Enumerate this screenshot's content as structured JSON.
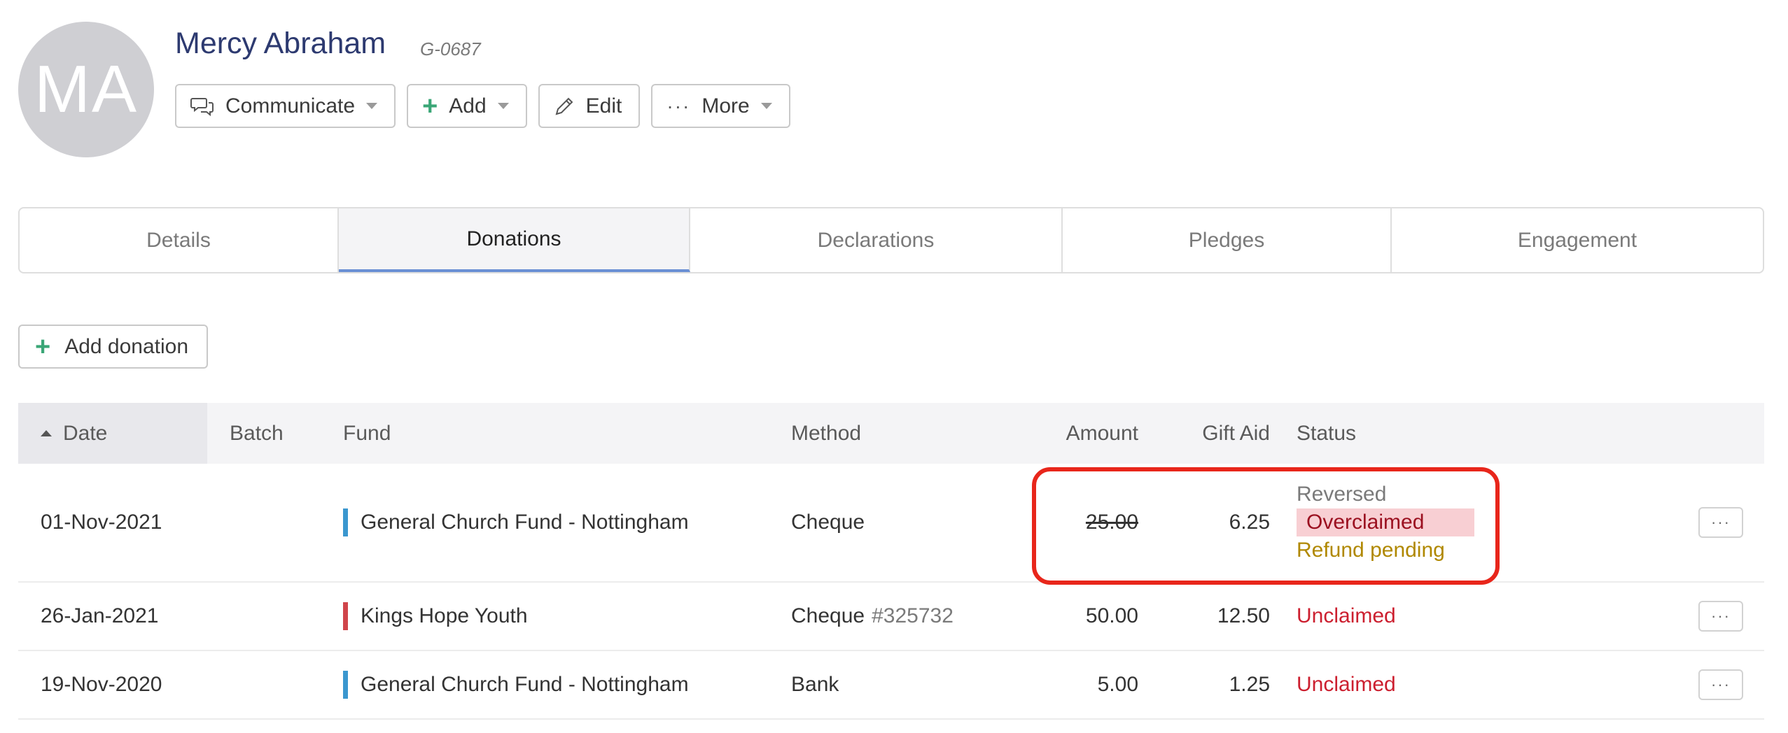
{
  "profile": {
    "initials": "MA",
    "name": "Mercy Abraham",
    "id": "G-0687"
  },
  "actions": [
    {
      "label": "Communicate",
      "icon": "chat-bubbles-icon",
      "dropdown": true
    },
    {
      "label": "Add",
      "icon": "plus-icon",
      "dropdown": true
    },
    {
      "label": "Edit",
      "icon": "pencil-icon",
      "dropdown": false
    },
    {
      "label": "More",
      "icon": "ellipsis-icon",
      "dropdown": true
    }
  ],
  "tabs": [
    {
      "label": "Details",
      "active": false
    },
    {
      "label": "Donations",
      "active": true
    },
    {
      "label": "Declarations",
      "active": false
    },
    {
      "label": "Pledges",
      "active": false
    },
    {
      "label": "Engagement",
      "active": false
    }
  ],
  "add_donation_label": "Add donation",
  "table": {
    "columns": [
      "Date",
      "Batch",
      "Fund",
      "Method",
      "Amount",
      "Gift Aid",
      "Status"
    ],
    "sorted_column": "Date",
    "rows": [
      {
        "date": "01-Nov-2021",
        "batch": "",
        "fund": "General Church Fund - Nottingham",
        "fund_color": "#3b97cf",
        "method": "Cheque",
        "method_ref": "",
        "amount": "25.00",
        "amount_struck": true,
        "gift_aid": "6.25",
        "status": [
          "Reversed",
          "Overclaimed",
          "Refund pending"
        ]
      },
      {
        "date": "26-Jan-2021",
        "batch": "",
        "fund": "Kings Hope Youth",
        "fund_color": "#d0454b",
        "method": "Cheque",
        "method_ref": "#325732",
        "amount": "50.00",
        "amount_struck": false,
        "gift_aid": "12.50",
        "status": [
          "Unclaimed"
        ]
      },
      {
        "date": "19-Nov-2020",
        "batch": "",
        "fund": "General Church Fund - Nottingham",
        "fund_color": "#3b97cf",
        "method": "Bank",
        "method_ref": "",
        "amount": "5.00",
        "amount_struck": false,
        "gift_aid": "1.25",
        "status": [
          "Unclaimed"
        ]
      }
    ]
  },
  "row_menu_label": "···",
  "colors": {
    "name": "#2d3a70",
    "accent_tab": "#6a8fd4",
    "unclaimed": "#cc1f2f",
    "overclaimed_bg": "#f8cfd3",
    "refund_pending": "#b08800",
    "highlight": "#e8261b"
  }
}
